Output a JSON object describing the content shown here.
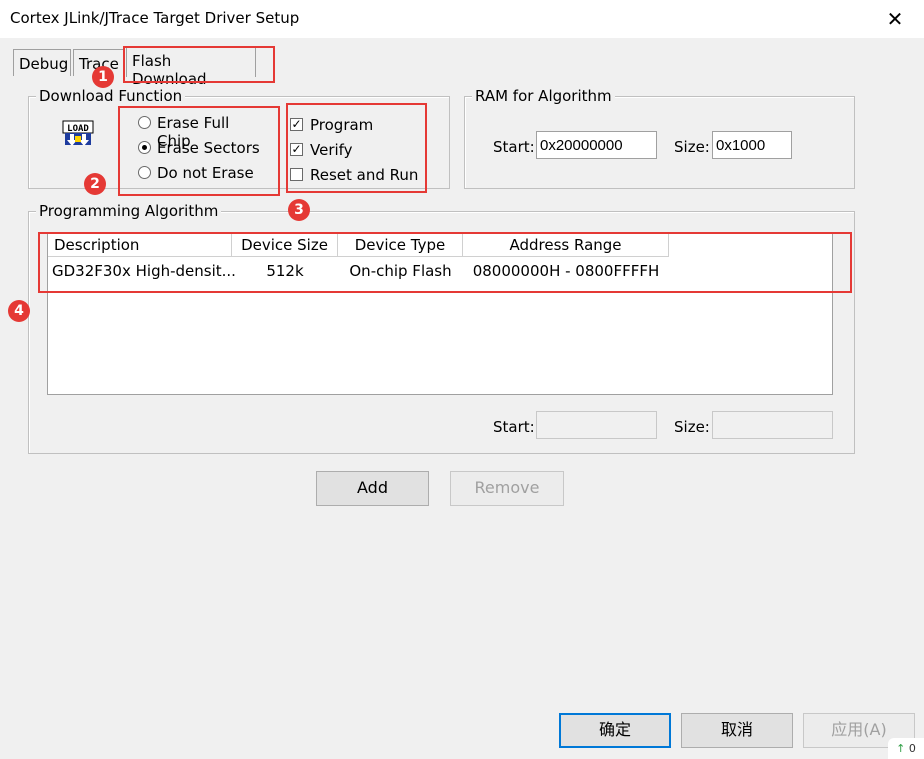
{
  "window": {
    "title": "Cortex JLink/JTrace Target Driver Setup",
    "close_glyph": "✕"
  },
  "tabs": [
    {
      "label": "Debug"
    },
    {
      "label": "Trace"
    },
    {
      "label": "Flash Download"
    }
  ],
  "download_function": {
    "label": "Download Function",
    "icon_text": "LOAD",
    "erase_options": [
      {
        "label": "Erase Full Chip",
        "checked": false
      },
      {
        "label": "Erase Sectors",
        "checked": true
      },
      {
        "label": "Do not Erase",
        "checked": false
      }
    ],
    "actions": [
      {
        "label": "Program",
        "checked": true
      },
      {
        "label": "Verify",
        "checked": true
      },
      {
        "label": "Reset and Run",
        "checked": false
      }
    ]
  },
  "ram": {
    "label": "RAM for Algorithm",
    "start_label": "Start:",
    "start_value": "0x20000000",
    "size_label": "Size:",
    "size_value": "0x1000"
  },
  "algorithm": {
    "label": "Programming Algorithm",
    "columns": [
      "Description",
      "Device Size",
      "Device Type",
      "Address Range"
    ],
    "rows": [
      [
        "GD32F30x High-densit...",
        "512k",
        "On-chip Flash",
        "08000000H - 0800FFFFH"
      ]
    ],
    "start_label": "Start:",
    "start_value": "",
    "size_label": "Size:",
    "size_value": ""
  },
  "buttons": {
    "add": "Add",
    "remove": "Remove",
    "ok": "确定",
    "cancel": "取消",
    "apply": "应用(A)"
  },
  "annotations": [
    "1",
    "2",
    "3",
    "4"
  ],
  "status_corner": {
    "arrow": "↑",
    "count": "0"
  },
  "colors": {
    "annotation": "#e53935",
    "accent": "#0078d7"
  }
}
